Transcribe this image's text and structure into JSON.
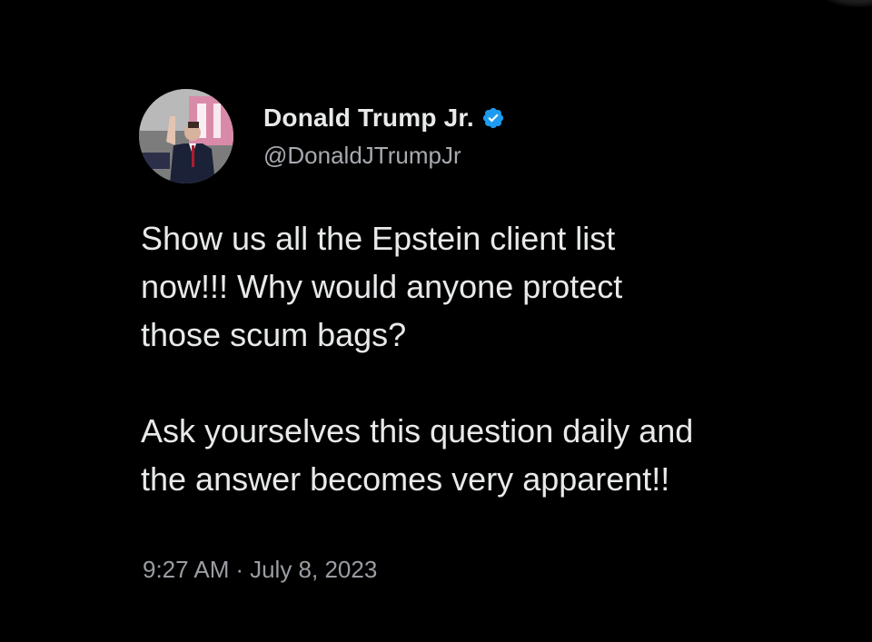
{
  "tweet": {
    "author": {
      "display_name": "Donald Trump Jr.",
      "handle": "@DonaldJTrumpJr",
      "verified": true,
      "verified_badge_color": "#1d9bf0"
    },
    "text_paragraphs": [
      "Show us all the Epstein client list\nnow!!! Why would anyone protect\nthose scum bags?",
      "Ask yourselves this question daily and\nthe answer becomes very apparent!!"
    ],
    "time": "9:27 AM",
    "separator": "·",
    "date": "July 8, 2023"
  },
  "theme": {
    "background": "#000000",
    "primary_text": "#e7e9ea",
    "secondary_text": "#a7abb0"
  },
  "icons": {
    "verified": "verified-badge-icon",
    "avatar": "profile-photo"
  }
}
